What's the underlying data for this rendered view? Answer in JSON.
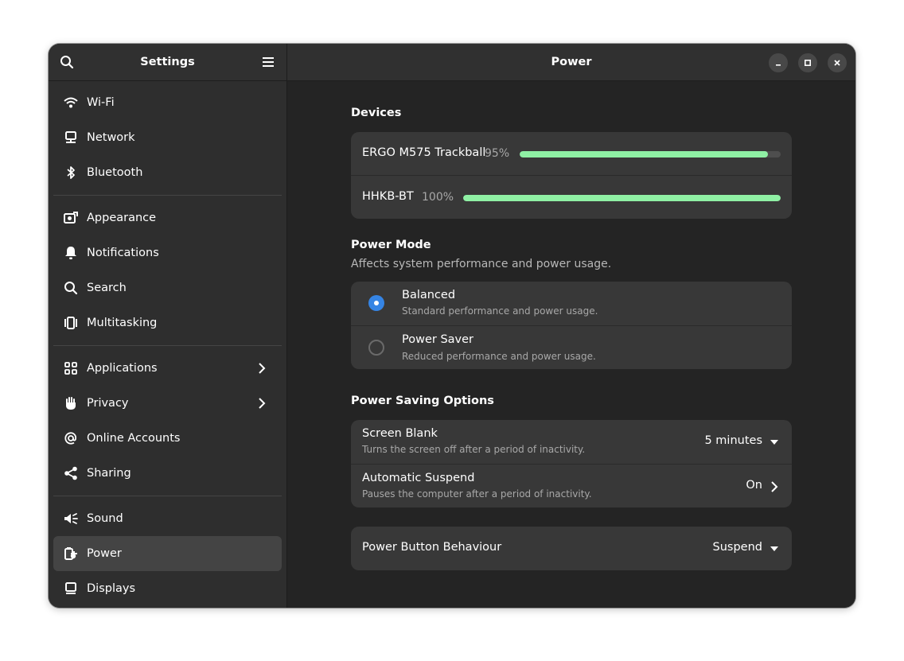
{
  "sidebar": {
    "title": "Settings",
    "search_icon": "search-icon",
    "menu_icon": "hamburger-menu-icon",
    "groups": [
      [
        {
          "name": "wifi",
          "label": "Wi-Fi",
          "icon": "wifi-icon"
        },
        {
          "name": "network",
          "label": "Network",
          "icon": "network-icon"
        },
        {
          "name": "bluetooth",
          "label": "Bluetooth",
          "icon": "bluetooth-icon"
        }
      ],
      [
        {
          "name": "appearance",
          "label": "Appearance",
          "icon": "appearance-icon"
        },
        {
          "name": "notifications",
          "label": "Notifications",
          "icon": "bell-icon"
        },
        {
          "name": "search",
          "label": "Search",
          "icon": "search-icon"
        },
        {
          "name": "multitasking",
          "label": "Multitasking",
          "icon": "multitasking-icon"
        }
      ],
      [
        {
          "name": "applications",
          "label": "Applications",
          "icon": "apps-grid-icon",
          "chevron": true
        },
        {
          "name": "privacy",
          "label": "Privacy",
          "icon": "hand-icon",
          "chevron": true
        },
        {
          "name": "online-accounts",
          "label": "Online Accounts",
          "icon": "at-icon"
        },
        {
          "name": "sharing",
          "label": "Sharing",
          "icon": "share-icon"
        }
      ],
      [
        {
          "name": "sound",
          "label": "Sound",
          "icon": "speaker-icon"
        },
        {
          "name": "power",
          "label": "Power",
          "icon": "power-plug-icon",
          "selected": true
        },
        {
          "name": "displays",
          "label": "Displays",
          "icon": "display-icon"
        }
      ]
    ]
  },
  "main": {
    "title": "Power",
    "devices": {
      "title": "Devices",
      "items": [
        {
          "name": "ERGO M575 Trackball",
          "percent_label": "95%",
          "level": 0.95
        },
        {
          "name": "HHKB-BT",
          "percent_label": "100%",
          "level": 1.0
        }
      ]
    },
    "power_mode": {
      "title": "Power Mode",
      "subtitle": "Affects system performance and power usage.",
      "options": [
        {
          "label": "Balanced",
          "desc": "Standard performance and power usage.",
          "selected": true
        },
        {
          "label": "Power Saver",
          "desc": "Reduced performance and power usage.",
          "selected": false
        }
      ]
    },
    "saving": {
      "title": "Power Saving Options",
      "screen_blank": {
        "label": "Screen Blank",
        "desc": "Turns the screen off after a period of inactivity.",
        "value": "5 minutes"
      },
      "auto_suspend": {
        "label": "Automatic Suspend",
        "desc": "Pauses the computer after a period of inactivity.",
        "value": "On"
      }
    },
    "power_button": {
      "label": "Power Button Behaviour",
      "value": "Suspend"
    }
  },
  "colors": {
    "accent": "#3584e4",
    "battery": "#8ff0a4",
    "window_bg": "#242424",
    "sidebar_bg": "#2e2e2e",
    "card_bg": "#383838"
  }
}
